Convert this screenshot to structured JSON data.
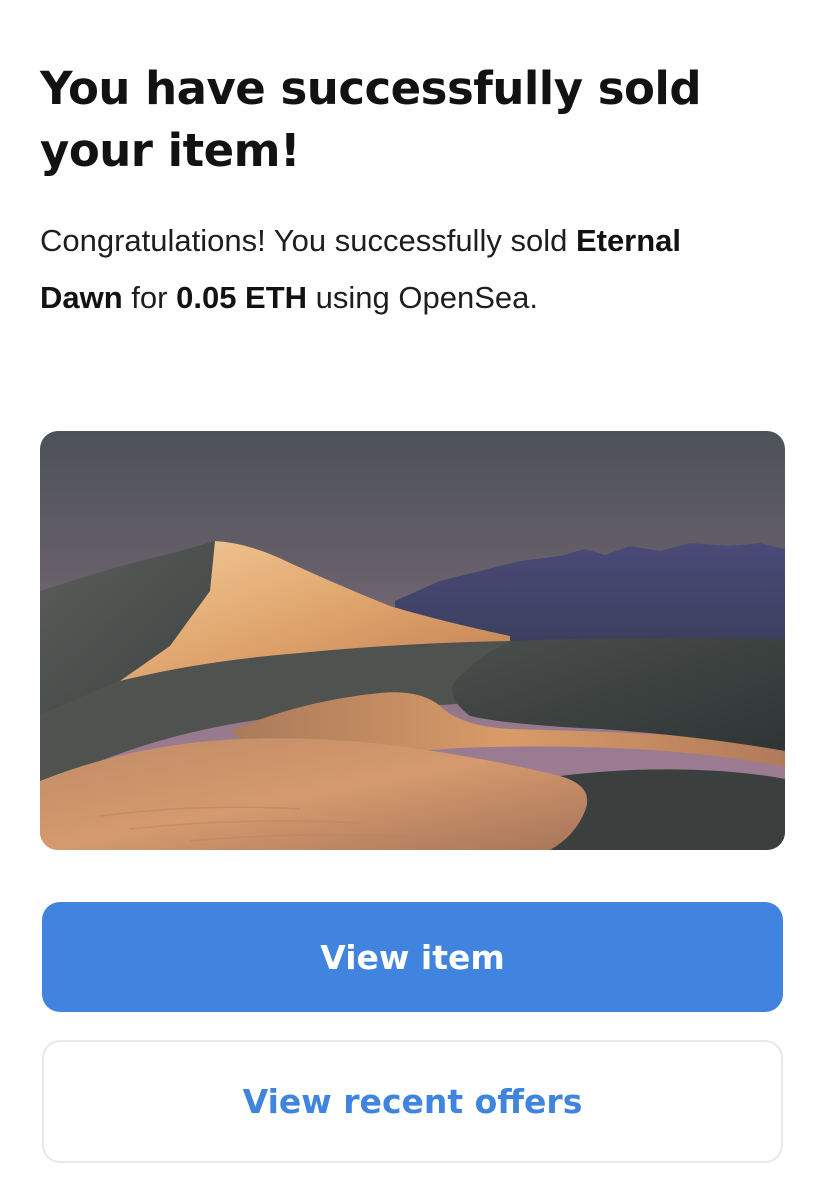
{
  "header": {
    "title": "You have successfully sold your item!"
  },
  "message": {
    "prefix": "Congratulations! You successfully sold ",
    "item_name": "Eternal Dawn",
    "middle": " for ",
    "price": "0.05 ETH",
    "suffix": " using OpenSea."
  },
  "artwork": {
    "subject": "desert-dunes-artwork"
  },
  "actions": {
    "view_item_label": "View item",
    "view_offers_label": "View recent offers"
  },
  "colors": {
    "primary": "#4184e0",
    "secondary_text": "#3f84de",
    "title_text": "#121212"
  }
}
